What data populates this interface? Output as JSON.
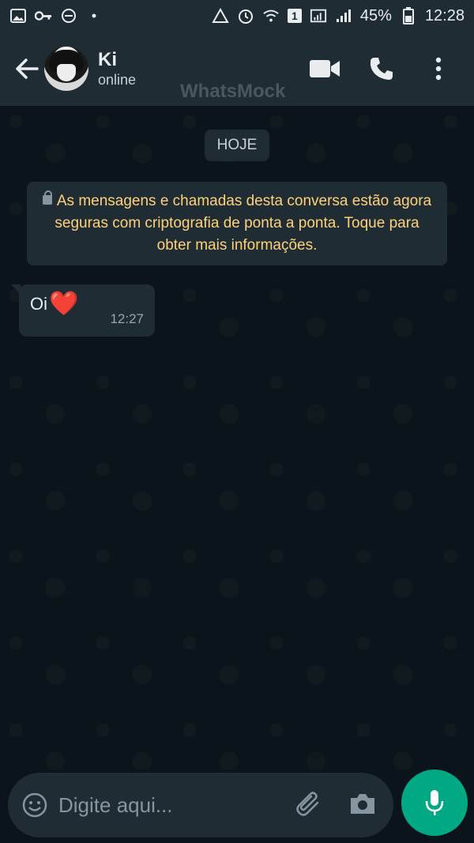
{
  "status_bar": {
    "battery_percent": "45%",
    "time": "12:28",
    "sim_badge": "1"
  },
  "header": {
    "contact_name": "Ki",
    "contact_status": "online",
    "watermark": "WhatsMock"
  },
  "chat": {
    "date_chip": "HOJE",
    "system_message": "As mensagens e chamadas desta conversa estão agora seguras com criptografia de ponta a ponta. Toque para obter mais informações.",
    "messages": [
      {
        "text": "Oi",
        "emoji": "❤️",
        "time": "12:27"
      }
    ]
  },
  "composer": {
    "placeholder": "Digite aqui..."
  },
  "colors": {
    "background": "#0b141a",
    "bar": "#1f2c34",
    "accent": "#00a884",
    "system_text": "#ffd279"
  },
  "icons": [
    "image-icon",
    "key-icon",
    "dnd-icon",
    "dot-icon",
    "recycle-icon",
    "alarm-icon",
    "wifi-icon",
    "signal-icon",
    "battery-icon",
    "back-arrow-icon",
    "video-call-icon",
    "phone-icon",
    "more-vertical-icon",
    "lock-icon",
    "emoji-icon",
    "attach-icon",
    "camera-icon",
    "mic-icon"
  ]
}
